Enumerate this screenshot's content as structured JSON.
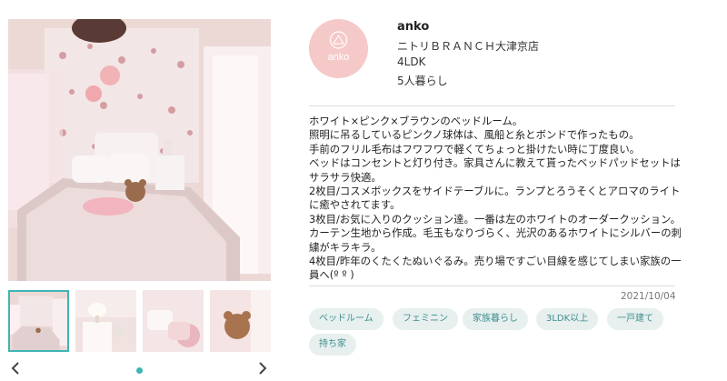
{
  "gallery": {
    "main_image": "bedroom-photo",
    "thumbnails": [
      "bedroom-photo",
      "side-table-photo",
      "cushion-photo",
      "stuffed-bear-photo"
    ],
    "selected_index": 1,
    "prev_icon": "chevron-left-icon",
    "next_icon": "chevron-right-icon",
    "page_dots": 1
  },
  "user": {
    "avatar_text": "anko",
    "name": "anko",
    "store": "ニトリＢＲＡＮＣＨ大津京店",
    "layout": "4LDK",
    "household": "5人暮らし"
  },
  "description_lines": [
    "ホワイト×ピンク×ブラウンのベッドルーム。",
    "照明に吊るしているピンクノ球体は、風船と糸とボンドで作ったもの。",
    "手前のフリル毛布はフワフワで軽くてちょっと掛けたい時に丁度良い。",
    "ベッドはコンセントと灯り付き。家具さんに教えて貰ったベッドパッドセットは",
    "サラサラ快適。",
    "2枚目/コスメボックスをサイドテーブルに。ランプとろうそくとアロマのライト",
    "に癒やされてます。",
    "3枚目/お気に入りのクッション達。一番は左のホワイトのオーダークッション。",
    "カーテン生地から作成。毛玉もなりづらく、光沢のあるホワイトにシルバーの刺",
    "繍がキラキラ。",
    "4枚目/昨年のくたくたぬいぐるみ。売り場ですごい目線を感じてしまい家族の一",
    "員へ(º º )"
  ],
  "post_date": "2021/10/04",
  "tags": [
    "ベッドルーム",
    "フェミニン",
    "家族暮らし",
    "3LDK以上",
    "一戸建て",
    "持ち家"
  ],
  "colors": {
    "accent": "#3fb4b4",
    "tag_bg": "#e7efef",
    "tag_text": "#3f8f8f",
    "avatar_bg": "#f6c9c9"
  }
}
